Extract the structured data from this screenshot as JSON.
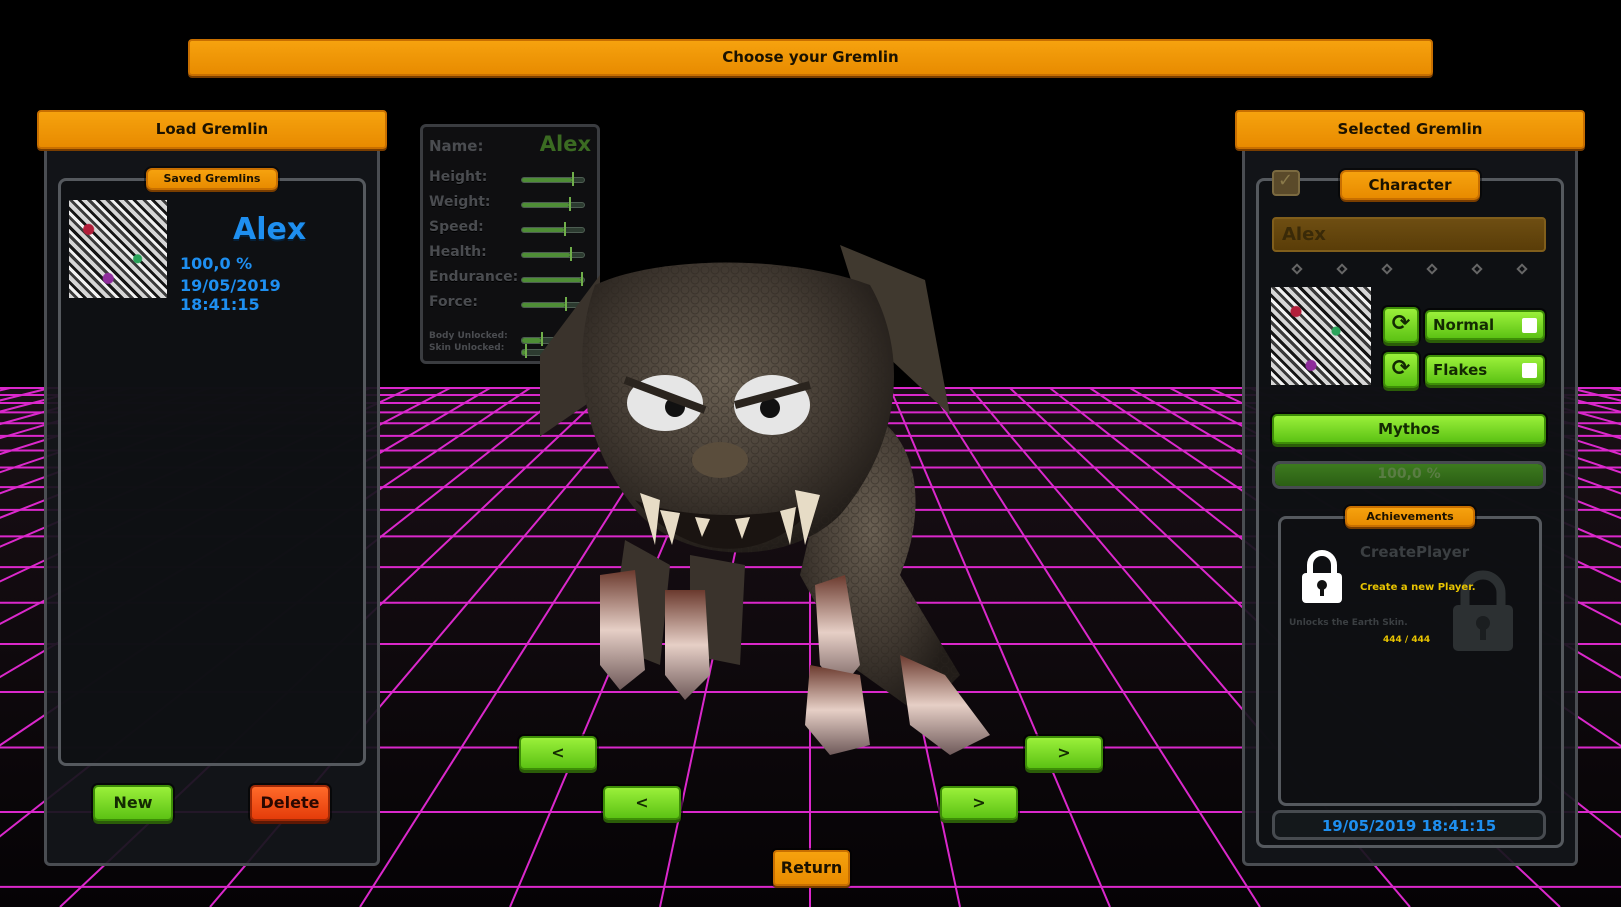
{
  "header": {
    "title": "Choose your Gremlin"
  },
  "load_panel": {
    "title": "Load Gremlin",
    "saved_label": "Saved Gremlins",
    "saved_items": [
      {
        "name": "Alex",
        "percent": "100,0 %",
        "date": "19/05/2019 18:41:15"
      }
    ],
    "new_label": "New",
    "delete_label": "Delete"
  },
  "stats": {
    "name_label": "Name:",
    "name_value": "Alex",
    "rows": [
      {
        "label": "Height:",
        "level": 0.8
      },
      {
        "label": "Weight:",
        "level": 0.75
      },
      {
        "label": "Speed:",
        "level": 0.68
      },
      {
        "label": "Health:",
        "level": 0.78
      },
      {
        "label": "Endurance:",
        "level": 0.95
      },
      {
        "label": "Force:",
        "level": 0.7
      }
    ],
    "body_unlocked_label": "Body Unlocked:",
    "skin_unlocked_label": "Skin Unlocked:",
    "body_unlocked_level": 0.3,
    "skin_unlocked_level": 0.05
  },
  "nav": {
    "upper_prev": "<",
    "upper_next": ">",
    "lower_prev": "<",
    "lower_next": ">",
    "return_label": "Return"
  },
  "selected_panel": {
    "title": "Selected Gremlin",
    "character_label": "Character",
    "name_input": "Alex",
    "body_option": "Normal",
    "skin_option": "Flakes",
    "type_label": "Mythos",
    "progress_text": "100,0 %",
    "progress": 1.0,
    "achievements_label": "Achievements",
    "achievement": {
      "title": "CreatePlayer",
      "description": "Create a new Player.",
      "reward": "Unlocks the Earth Skin.",
      "count": "444 / 444"
    },
    "date": "19/05/2019 18:41:15"
  },
  "colors": {
    "orange": "#f29a0a",
    "green": "#7ad82a",
    "red": "#f04e14",
    "accent_blue": "#1e8ff0",
    "grid_magenta": "#e62ad6"
  }
}
